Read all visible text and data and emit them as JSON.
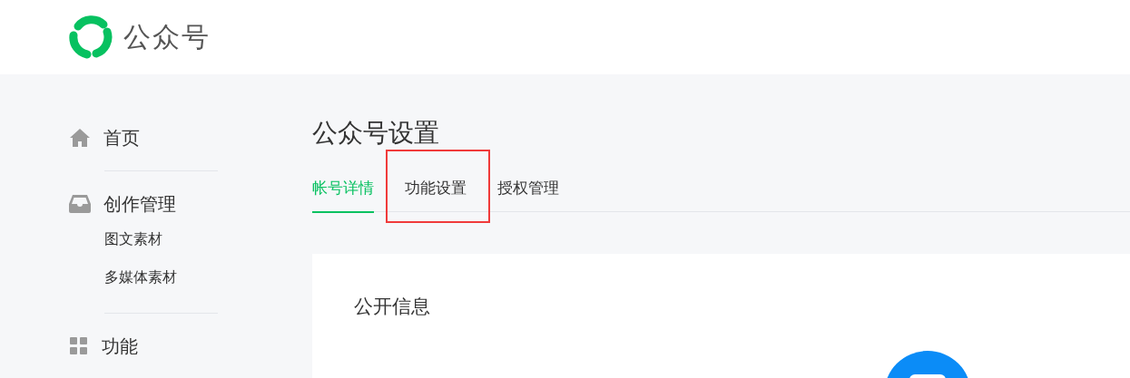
{
  "header": {
    "title": "公众号"
  },
  "sidebar": {
    "items": [
      {
        "label": "首页",
        "kind": "section"
      },
      {
        "kind": "divider"
      },
      {
        "label": "创作管理",
        "kind": "section"
      },
      {
        "label": "图文素材",
        "kind": "sub"
      },
      {
        "label": "多媒体素材",
        "kind": "sub"
      },
      {
        "kind": "divider"
      },
      {
        "label": "功能",
        "kind": "section"
      }
    ]
  },
  "page": {
    "title": "公众号设置",
    "tabs": [
      {
        "label": "帐号详情",
        "selected": true,
        "highlighted": false
      },
      {
        "label": "功能设置",
        "selected": false,
        "highlighted": true
      },
      {
        "label": "授权管理",
        "selected": false,
        "highlighted": false
      }
    ],
    "card": {
      "title": "公开信息"
    }
  }
}
